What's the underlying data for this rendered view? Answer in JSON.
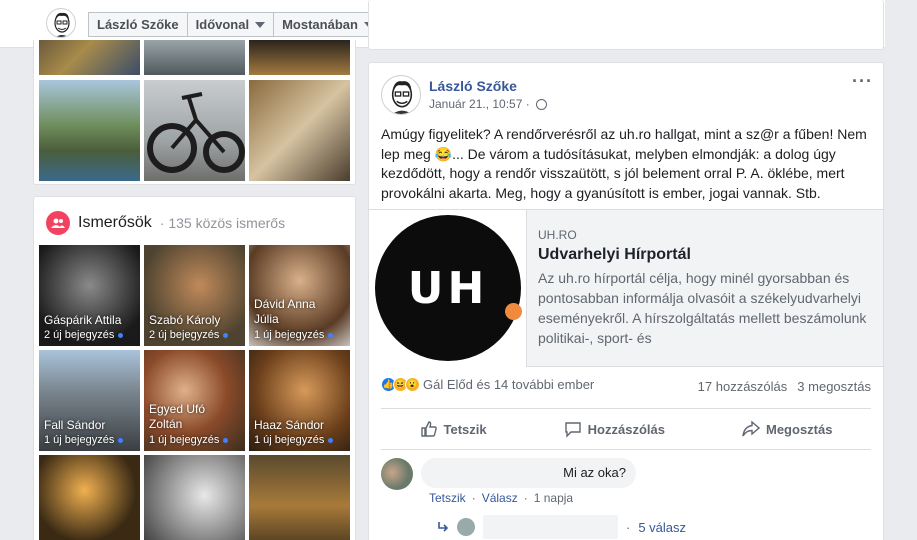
{
  "header": {
    "profile_name": "László Szőke",
    "timeline_label": "Idővonal",
    "trending_label": "Mostanában"
  },
  "friends": {
    "title": "Ismerősök",
    "subtitle": "· 135 közös ismerős",
    "items": [
      {
        "name": "Gáspárik Attila",
        "count": "2 új bejegyzés"
      },
      {
        "name": "Szabó Károly",
        "count": "2 új bejegyzés"
      },
      {
        "name": "Dávid Anna Júlia",
        "count": "1 új bejegyzés"
      },
      {
        "name": "Fall Sándor",
        "count": "1 új bejegyzés"
      },
      {
        "name": "Egyed Ufó Zoltán",
        "count": "1 új bejegyzés"
      },
      {
        "name": "Haaz Sándor",
        "count": "1 új bejegyzés"
      }
    ]
  },
  "post": {
    "author": "László Szőke",
    "time": "Január 21., 10:57 ·",
    "more": "···",
    "text": "Amúgy figyelitek? A rendőrverésről az uh.ro hallgat, mint a sz@r a fűben! Nem lep meg 😂... De várom a tudósításukat, melyben elmondják: a dolog úgy kezdődött, hogy a rendőr visszaütött, s jól belement orral P. A. öklébe, mert provokálni akarta. Meg, hogy a gyanúsított is ember, jogai vannak. Stb.",
    "link": {
      "logo_text": "UH",
      "domain": "UH.RO",
      "title": "Udvarhelyi Hírportál",
      "description": "Az uh.ro hírportál célja, hogy minél gyorsabban és pontosabban informálja olvasóit a székelyudvarhelyi eseményekről. A hírszolgáltatás mellett beszámolunk politikai-, sport- és"
    },
    "reactions_text": "Gál Előd és 14 további ember",
    "comments_count": "17 hozzászólás",
    "shares_count": "3 megosztás",
    "actions": {
      "like": "Tetszik",
      "comment": "Hozzászólás",
      "share": "Megosztás"
    },
    "comment": {
      "text": "Mi az oka?",
      "like": "Tetszik",
      "reply": "Válasz",
      "time": "1 napja",
      "replies": "5 válasz"
    }
  },
  "colors": {
    "link_blue": "#385898",
    "friends_icon": "#f3425f",
    "uh_accent": "#f08a3c"
  }
}
